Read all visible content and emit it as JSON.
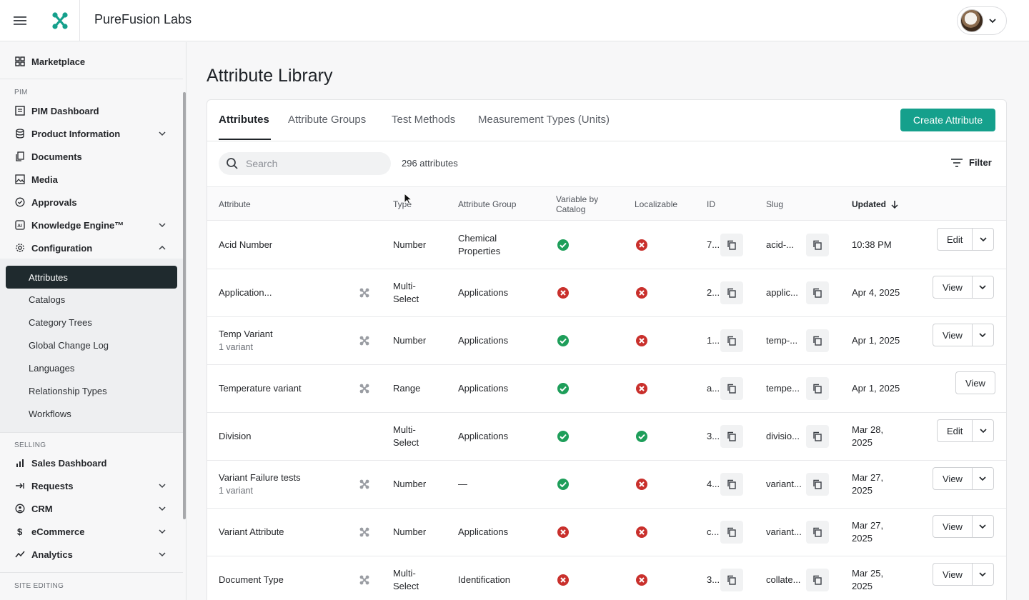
{
  "header": {
    "org_name": "PureFusion Labs"
  },
  "sidebar": {
    "marketplace": "Marketplace",
    "sections": {
      "pim": "PIM",
      "selling": "SELLING",
      "site_editing": "SITE EDITING"
    },
    "pim_items": [
      "PIM Dashboard",
      "Product Information",
      "Documents",
      "Media",
      "Approvals",
      "Knowledge Engine™",
      "Configuration"
    ],
    "config_items": [
      "Attributes",
      "Catalogs",
      "Category Trees",
      "Global Change Log",
      "Languages",
      "Relationship Types",
      "Workflows"
    ],
    "selling_items": [
      "Sales Dashboard",
      "Requests",
      "CRM",
      "eCommerce",
      "Analytics"
    ]
  },
  "page": {
    "title": "Attribute Library"
  },
  "tabs": [
    "Attributes",
    "Attribute Groups",
    "Test Methods",
    "Measurement Types (Units)"
  ],
  "toolbar": {
    "create_label": "Create Attribute",
    "search_placeholder": "Search",
    "count": "296 attributes",
    "filter_label": "Filter"
  },
  "table": {
    "headers": {
      "attribute": "Attribute",
      "type": "Type",
      "group": "Attribute Group",
      "variable_line1": "Variable by",
      "variable_line2": "Catalog",
      "localizable": "Localizable",
      "id": "ID",
      "slug": "Slug",
      "updated": "Updated"
    },
    "rows": [
      {
        "name": "Acid Number",
        "sub": "",
        "variant_icon": false,
        "type1": "Number",
        "type2": "",
        "group1": "Chemical",
        "group2": "Properties",
        "variable": true,
        "localizable": false,
        "id": "7...",
        "slug": "acid-...",
        "upd1": "10:38 PM",
        "upd2": "",
        "action": "Edit",
        "dropdown": true
      },
      {
        "name": "Application...",
        "sub": "",
        "variant_icon": true,
        "type1": "Multi-",
        "type2": "Select",
        "group1": "Applications",
        "group2": "",
        "variable": false,
        "localizable": false,
        "id": "2...",
        "slug": "applic...",
        "upd1": "Apr 4, 2025",
        "upd2": "",
        "action": "View",
        "dropdown": true
      },
      {
        "name": "Temp Variant",
        "sub": "1 variant",
        "variant_icon": true,
        "type1": "Number",
        "type2": "",
        "group1": "Applications",
        "group2": "",
        "variable": true,
        "localizable": false,
        "id": "1...",
        "slug": "temp-...",
        "upd1": "Apr 1, 2025",
        "upd2": "",
        "action": "View",
        "dropdown": true
      },
      {
        "name": "Temperature variant",
        "sub": "",
        "variant_icon": true,
        "type1": "Range",
        "type2": "",
        "group1": "Applications",
        "group2": "",
        "variable": true,
        "localizable": false,
        "id": "a...",
        "slug": "tempe...",
        "upd1": "Apr 1, 2025",
        "upd2": "",
        "action": "View",
        "dropdown": false
      },
      {
        "name": "Division",
        "sub": "",
        "variant_icon": false,
        "type1": "Multi-",
        "type2": "Select",
        "group1": "Applications",
        "group2": "",
        "variable": true,
        "localizable": true,
        "id": "3...",
        "slug": "divisio...",
        "upd1": "Mar 28,",
        "upd2": "2025",
        "action": "Edit",
        "dropdown": true
      },
      {
        "name": "Variant Failure tests",
        "sub": "1 variant",
        "variant_icon": true,
        "type1": "Number",
        "type2": "",
        "group1": "—",
        "group2": "",
        "variable": true,
        "localizable": false,
        "id": "4...",
        "slug": "variant...",
        "upd1": "Mar 27,",
        "upd2": "2025",
        "action": "View",
        "dropdown": true
      },
      {
        "name": "Variant Attribute",
        "sub": "",
        "variant_icon": true,
        "type1": "Number",
        "type2": "",
        "group1": "Applications",
        "group2": "",
        "variable": false,
        "localizable": false,
        "id": "c...",
        "slug": "variant...",
        "upd1": "Mar 27,",
        "upd2": "2025",
        "action": "View",
        "dropdown": true
      },
      {
        "name": "Document Type",
        "sub": "",
        "variant_icon": true,
        "type1": "Multi-",
        "type2": "Select",
        "group1": "Identification",
        "group2": "",
        "variable": false,
        "localizable": false,
        "id": "3...",
        "slug": "collate...",
        "upd1": "Mar 25,",
        "upd2": "2025",
        "action": "View",
        "dropdown": true
      }
    ]
  },
  "colors": {
    "accent": "#15a08c",
    "check": "#1e9e5a",
    "cross": "#c9302c",
    "active_nav": "#1f2a2e"
  }
}
